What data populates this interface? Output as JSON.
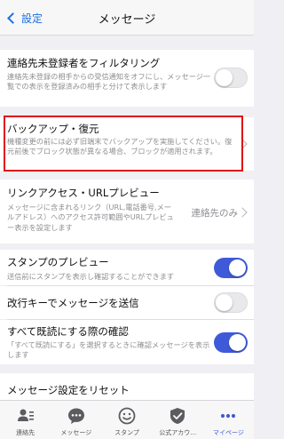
{
  "nav": {
    "back_label": "設定",
    "title": "メッセージ"
  },
  "settings": {
    "filter": {
      "title": "連絡先未登録者をフィルタリング",
      "desc": "連絡先未登録の相手からの受信通知をオフにし、メッセージ一覧での表示を登録済みの相手と分けて表示します",
      "enabled": false
    },
    "backup": {
      "title": "バックアップ・復元",
      "desc": "機種変更の前には必ず旧端末でバックアップを実施してください。復元前後でブロック状態が異なる場合、ブロックが適用されます。"
    },
    "link_access": {
      "title": "リンクアクセス・URLプレビュー",
      "value": "連絡先のみ",
      "desc": "メッセージに含まれるリンク（URL,電話番号,メールアドレス）へのアクセス許可範囲やURLプレビュー表示を設定します"
    },
    "stamp_preview": {
      "title": "スタンプのプレビュー",
      "desc": "送信前にスタンプを表示し確認することができます",
      "enabled": true
    },
    "enter_send": {
      "title": "改行キーでメッセージを送信",
      "enabled": false
    },
    "mark_all_read": {
      "title": "すべて既読にする際の確認",
      "desc": "「すべて既読にする」を選択するときに確認メッセージを表示します",
      "enabled": true
    },
    "reset": {
      "title": "メッセージ設定をリセット"
    }
  },
  "tabbar": {
    "items": [
      {
        "label": "連絡先",
        "icon": "contacts-icon"
      },
      {
        "label": "メッセージ",
        "icon": "message-icon"
      },
      {
        "label": "スタンプ",
        "icon": "stamp-icon"
      },
      {
        "label": "公式アカウ…",
        "icon": "official-account-icon"
      },
      {
        "label": "マイページ",
        "icon": "more-icon",
        "active": true
      }
    ]
  },
  "colors": {
    "accent": "#3f5ad8",
    "highlight": "#e01010",
    "link": "#1c6fe0"
  }
}
